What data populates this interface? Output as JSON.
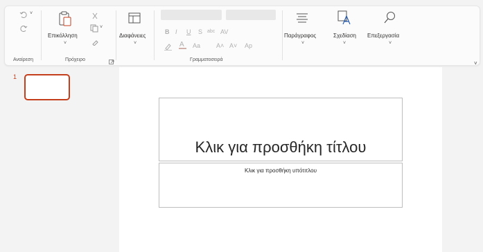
{
  "ribbon": {
    "undo": {
      "label": "Αναίρεση"
    },
    "clipboard": {
      "label": "Πρόχειρο",
      "paste_label": "Επικόλληση"
    },
    "slides": {
      "layout_label": "Διαφάνειες"
    },
    "font": {
      "label": "Γραμματοσειρά",
      "bold": "B",
      "italic": "I",
      "underline": "U",
      "strike": "S",
      "abc": "abc",
      "spacing": "AV",
      "case": "Aa",
      "grow": "A˄",
      "shrink": "A˅",
      "clear": "Ap"
    },
    "paragraph": {
      "label": "Παράγραφος"
    },
    "drawing": {
      "label": "Σχεδίαση"
    },
    "editing": {
      "label": "Επεξεργασία"
    }
  },
  "thumbnails": [
    {
      "number": "1"
    }
  ],
  "slide": {
    "title_placeholder": "Κλικ για προσθήκη τίτλου",
    "subtitle_placeholder": "Κλικ για προσθήκη υπότιτλου"
  },
  "colors": {
    "accent": "#c43e1c",
    "ribbon_bg": "#fbfbfb",
    "app_bg": "#f3f3f3"
  }
}
